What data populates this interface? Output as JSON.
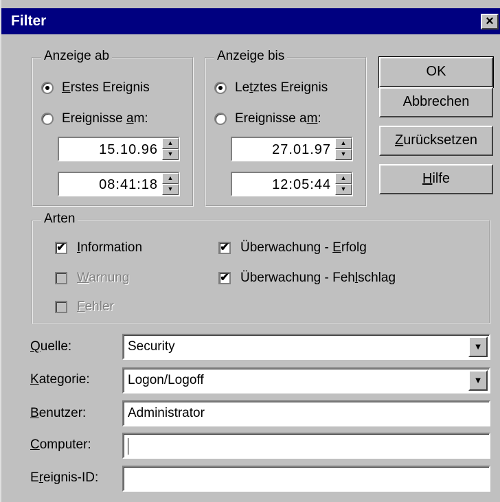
{
  "dialog": {
    "title": "Filter",
    "close_glyph": "×"
  },
  "anzeige_ab": {
    "label": "Anzeige ab",
    "option_first": {
      "pre": "",
      "u": "E",
      "post": "rstes Ereignis",
      "selected": true
    },
    "option_date": {
      "pre": "Ereignisse ",
      "u": "a",
      "post": "m:",
      "selected": false
    },
    "date": "15.10.96",
    "time": "08:41:18"
  },
  "anzeige_bis": {
    "label": "Anzeige bis",
    "option_last": {
      "pre": "Le",
      "u": "t",
      "post": "ztes Ereignis",
      "selected": true
    },
    "option_date": {
      "pre": "Ereignisse a",
      "u": "m",
      "post": ":",
      "selected": false
    },
    "date": "27.01.97",
    "time": "12:05:44"
  },
  "buttons": {
    "ok": "OK",
    "cancel": "Abbrechen",
    "reset": {
      "pre": "",
      "u": "Z",
      "post": "urücksetzen"
    },
    "help": {
      "pre": "",
      "u": "H",
      "post": "ilfe"
    }
  },
  "arten": {
    "label": "Arten",
    "information": {
      "pre": "",
      "u": "I",
      "post": "nformation",
      "checked": true,
      "enabled": true
    },
    "warnung": {
      "pre": "",
      "u": "W",
      "post": "arnung",
      "checked": false,
      "enabled": false
    },
    "fehler": {
      "pre": "",
      "u": "F",
      "post": "ehler",
      "checked": false,
      "enabled": false
    },
    "audit_success": {
      "pre": "Überwachung - ",
      "u": "E",
      "post": "rfolg",
      "checked": true,
      "enabled": true
    },
    "audit_failure": {
      "pre": "Überwachung - Feh",
      "u": "l",
      "post": "schlag",
      "checked": true,
      "enabled": true
    }
  },
  "fields": {
    "quelle": {
      "pre": "",
      "u": "Q",
      "post": "uelle:",
      "value": "Security"
    },
    "kategorie": {
      "pre": "",
      "u": "K",
      "post": "ategorie:",
      "value": "Logon/Logoff"
    },
    "benutzer": {
      "pre": "",
      "u": "B",
      "post": "enutzer:",
      "value": "Administrator"
    },
    "computer": {
      "pre": "",
      "u": "C",
      "post": "omputer:",
      "value": ""
    },
    "ereignis_id": {
      "pre": "E",
      "u": "r",
      "post": "eignis-ID:",
      "value": ""
    }
  },
  "glyphs": {
    "check": "✔",
    "spin_up": "▲",
    "spin_down": "▼",
    "combo_arrow": "▼"
  },
  "colors": {
    "titlebar": "#000080",
    "face": "#c0c0c0",
    "disabled_text": "#808080"
  }
}
